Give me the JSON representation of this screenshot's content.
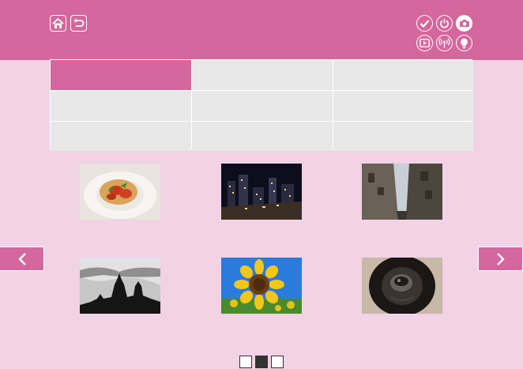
{
  "colors": {
    "accent": "#d4679d",
    "background": "#f2d2e5",
    "cell": "#e8e8e8",
    "border": "#ffffff"
  },
  "header": {
    "left_buttons": [
      {
        "icon": "home-icon"
      },
      {
        "icon": "back-icon"
      }
    ],
    "right_buttons": [
      {
        "icon": "checkmark-icon"
      },
      {
        "icon": "power-icon"
      },
      {
        "icon": "camera-icon",
        "active": true
      },
      {
        "icon": "play-icon"
      },
      {
        "icon": "wireless-icon"
      },
      {
        "icon": "lightbulb-icon"
      }
    ]
  },
  "category_grid": {
    "rows": 3,
    "columns": 3,
    "selected_cell": 0
  },
  "gallery": {
    "images": [
      {
        "subject": "pasta-dish"
      },
      {
        "subject": "night-city"
      },
      {
        "subject": "narrow-alley"
      },
      {
        "subject": "cathedral-silhouette"
      },
      {
        "subject": "sunflower"
      },
      {
        "subject": "dog-face"
      }
    ]
  },
  "navigation": {
    "prev_icon": "chevron-left-icon",
    "next_icon": "chevron-right-icon"
  },
  "pagination": {
    "total_pages": 3,
    "current_page": 2
  }
}
